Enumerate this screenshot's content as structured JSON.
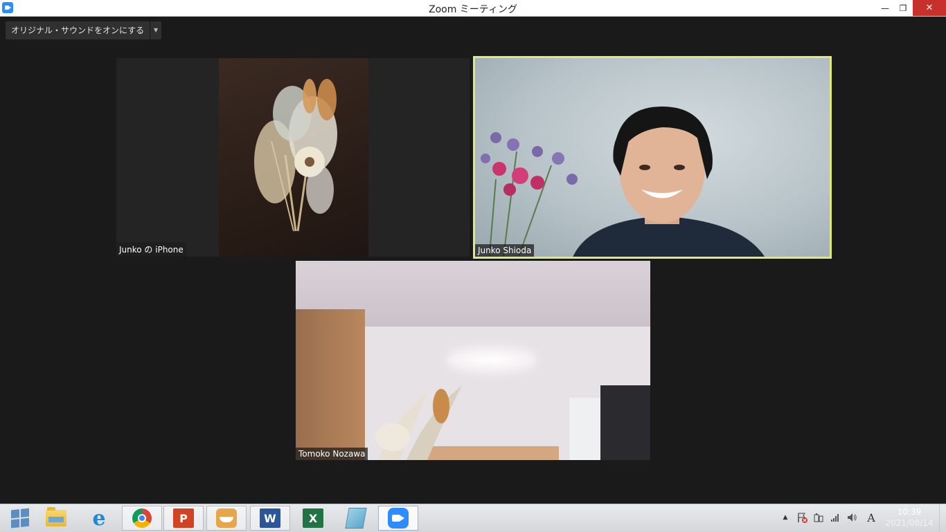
{
  "window": {
    "title": "Zoom ミーティング",
    "minimize_glyph": "—",
    "restore_glyph": "❐",
    "close_glyph": "✕"
  },
  "toolbar": {
    "original_sound_label": "オリジナル・サウンドをオンにする",
    "original_sound_caret": "▼"
  },
  "participants": [
    {
      "name": "Junko の iPhone",
      "active_speaker": false
    },
    {
      "name": "Junko Shioda",
      "active_speaker": true
    },
    {
      "name": "Tomoko Nozawa",
      "active_speaker": false
    }
  ],
  "taskbar": {
    "apps": [
      {
        "icon": "windows-start-icon"
      },
      {
        "icon": "file-explorer-icon"
      },
      {
        "icon": "internet-explorer-icon",
        "glyph": "e"
      },
      {
        "icon": "chrome-icon"
      },
      {
        "icon": "powerpoint-icon",
        "glyph": "P"
      },
      {
        "icon": "smile-app-icon"
      },
      {
        "icon": "word-icon",
        "glyph": "W"
      },
      {
        "icon": "excel-icon",
        "glyph": "X"
      },
      {
        "icon": "notepad-icon"
      },
      {
        "icon": "zoom-icon"
      }
    ],
    "tray": {
      "chevron": "▲",
      "ime_glyph": "A",
      "time": "10:39",
      "date": "2021/08/14"
    }
  },
  "colors": {
    "active_speaker_border": "#dfe87a",
    "meeting_background": "#1a1a1a",
    "close_button": "#c7302b",
    "zoom_blue": "#2d8cff"
  }
}
